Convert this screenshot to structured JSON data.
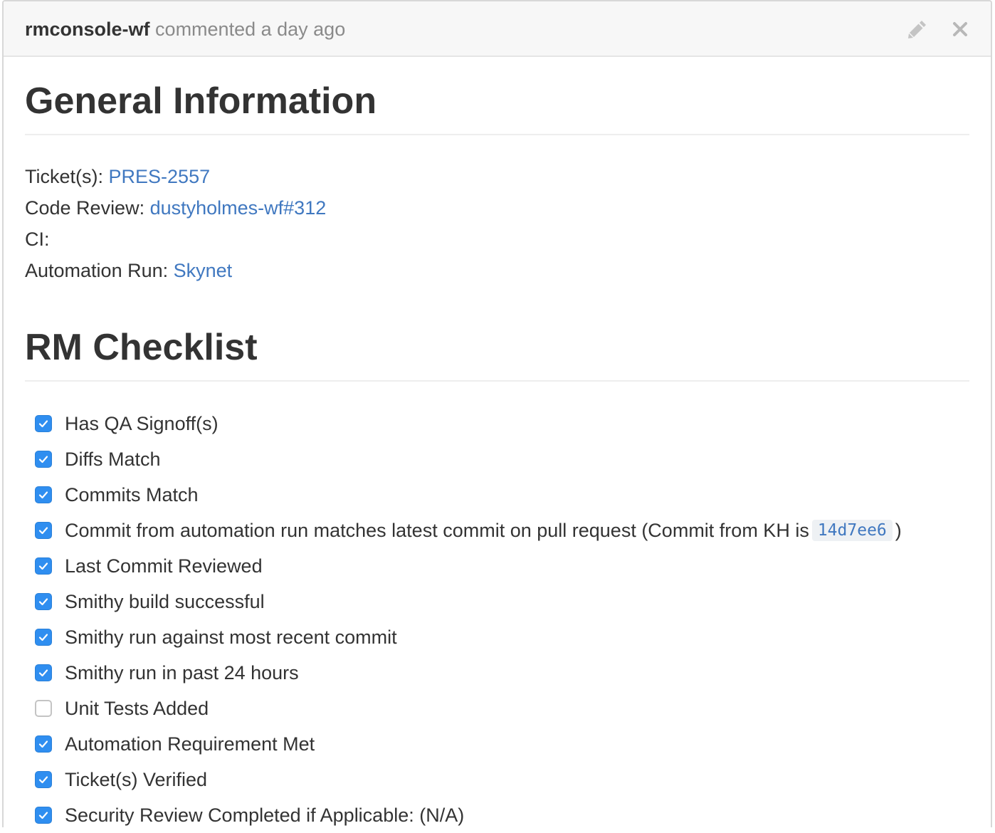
{
  "header": {
    "author": "rmconsole-wf",
    "action_text": "commented a day ago",
    "edit_icon": "pencil-icon",
    "close_icon": "close-icon"
  },
  "general": {
    "heading": "General Information",
    "ticket_label": "Ticket(s):",
    "ticket_link": "PRES-2557",
    "code_review_label": "Code Review:",
    "code_review_link": "dustyholmes-wf#312",
    "ci_label": "CI:",
    "automation_label": "Automation Run:",
    "automation_link": "Skynet"
  },
  "checklist": {
    "heading": "RM Checklist",
    "items": [
      {
        "label": "Has QA Signoff(s)",
        "checked": true
      },
      {
        "label": "Diffs Match",
        "checked": true
      },
      {
        "label": "Commits Match",
        "checked": true
      },
      {
        "label": "Commit from automation run matches latest commit on pull request (Commit from KH is",
        "code": "14d7ee6",
        "suffix": ")",
        "checked": true
      },
      {
        "label": "Last Commit Reviewed",
        "checked": true
      },
      {
        "label": "Smithy build successful",
        "checked": true
      },
      {
        "label": "Smithy run against most recent commit",
        "checked": true
      },
      {
        "label": "Smithy run in past 24 hours",
        "checked": true
      },
      {
        "label": "Unit Tests Added",
        "checked": false
      },
      {
        "label": "Automation Requirement Met",
        "checked": true
      },
      {
        "label": "Ticket(s) Verified",
        "checked": true
      },
      {
        "label": "Security Review Completed if Applicable: (N/A)",
        "checked": true
      }
    ]
  },
  "colors": {
    "link": "#4078c0",
    "checkbox_checked": "#2f8ef0",
    "header_bg": "#f7f7f7"
  }
}
